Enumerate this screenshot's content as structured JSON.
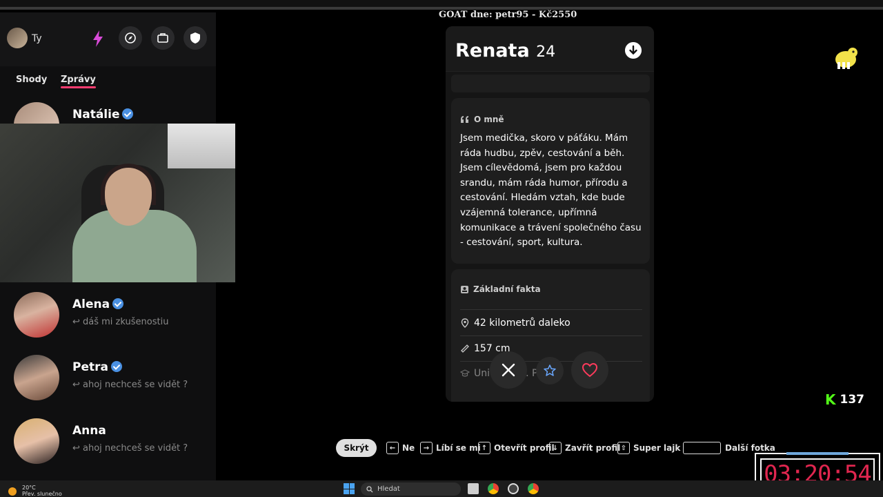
{
  "banner": {
    "goat": "GOAT dne: petr95 - Kč2550"
  },
  "sidebar": {
    "me_label": "Ty",
    "tabs": [
      {
        "label": "Shody"
      },
      {
        "label": "Zprávy"
      }
    ],
    "conversations": [
      {
        "name": "Natálie",
        "verified": true,
        "message": ""
      },
      {
        "name": "Alena",
        "verified": true,
        "message": "↩ dáš mi zkušenostiu"
      },
      {
        "name": "Petra",
        "verified": true,
        "message": "↩ ahoj nechceš se vidět ?"
      },
      {
        "name": "Anna",
        "verified": false,
        "message": "↩ ahoj nechceš se vidět ?"
      }
    ]
  },
  "profile": {
    "name": "Renata",
    "age": "24",
    "about_title": "O mně",
    "bio": "Jsem medička, skoro v páťáku. Mám ráda hudbu, zpěv, cestování a běh. Jsem cílevědomá, jsem pro každou srandu, mám ráda humor, přírodu a cestování. Hledám vztah, kde bude vzájemná tolerance, upřímná komunikace a trávení společného času - cestování, sport, kultura.",
    "facts_title": "Základní fakta",
    "facts": [
      {
        "icon": "location-pin-icon",
        "text": "42 kilometrů daleko"
      },
      {
        "icon": "ruler-icon",
        "text": "157 cm"
      },
      {
        "icon": "graduation-cap-icon",
        "text": "Univ... ari... Pr..."
      }
    ]
  },
  "hints": {
    "hide": "Skrýt",
    "items": [
      {
        "key": "←",
        "label": "Ne"
      },
      {
        "key": "→",
        "label": "Líbí se mi"
      },
      {
        "key": "↑",
        "label": "Otevřít profil"
      },
      {
        "key": "↓",
        "label": "Zavřít profil"
      },
      {
        "key": "⇧",
        "label": "Super lajk"
      },
      {
        "key": "space",
        "label": "Další fotka"
      }
    ]
  },
  "overlay": {
    "kick_count": "137",
    "timer": "03:20:54"
  },
  "taskbar": {
    "weather_temp": "20°C",
    "weather_desc": "Přev. slunečno",
    "search_placeholder": "Hledat"
  },
  "colors": {
    "accent": "#ff3d71",
    "verified": "#4a90e2",
    "kick": "#53fc18",
    "timer": "#e0264f"
  }
}
